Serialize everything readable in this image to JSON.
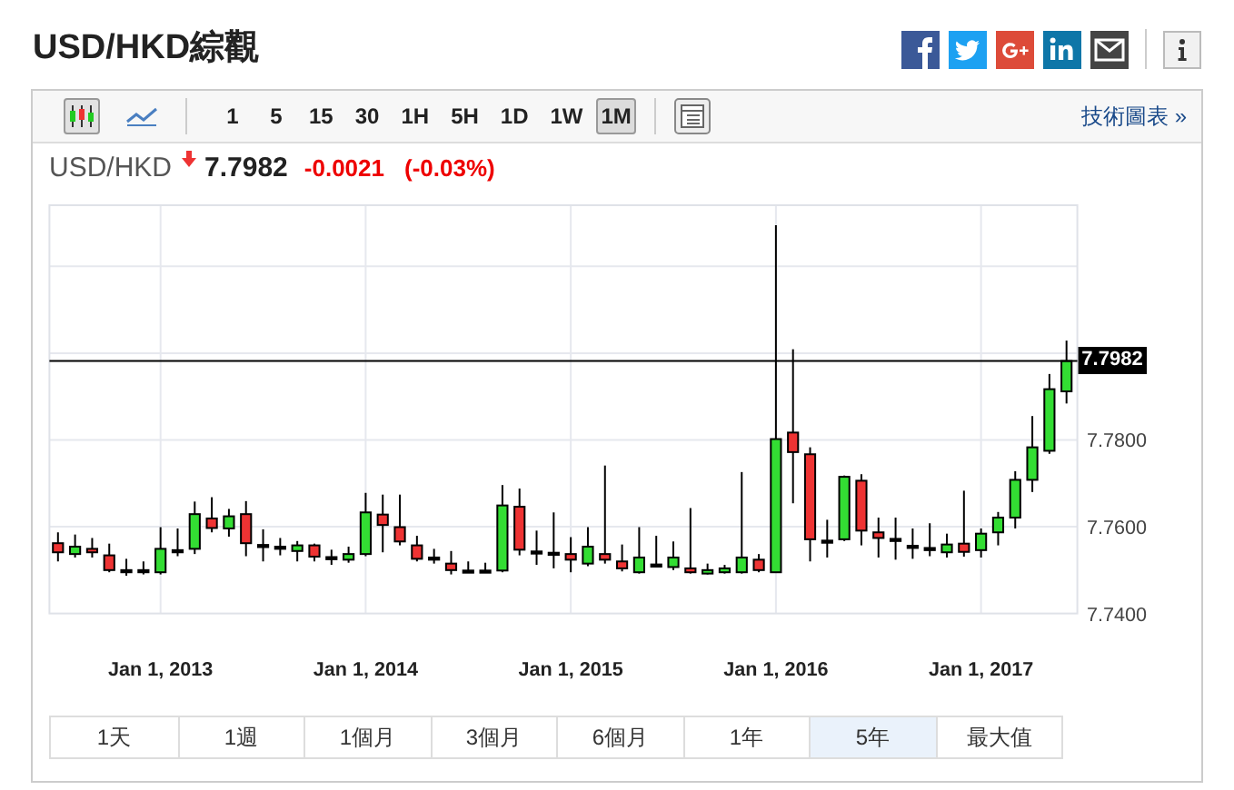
{
  "title": "USD/HKD綜觀",
  "toolbar": {
    "chart_types": [
      {
        "kind": "candles",
        "selected": true
      },
      {
        "kind": "line",
        "selected": false
      }
    ],
    "intervals": [
      {
        "label": "1",
        "selected": false
      },
      {
        "label": "5",
        "selected": false
      },
      {
        "label": "15",
        "selected": false
      },
      {
        "label": "30",
        "selected": false
      },
      {
        "label": "1H",
        "selected": false
      },
      {
        "label": "5H",
        "selected": false
      },
      {
        "label": "1D",
        "selected": false
      },
      {
        "label": "1W",
        "selected": false
      },
      {
        "label": "1M",
        "selected": true
      }
    ],
    "link": "技術圖表 »"
  },
  "quote": {
    "symbol": "USD/HKD",
    "falling": true,
    "price": "7.7982",
    "change": "-0.0021",
    "change_percent": "(-0.03%)"
  },
  "chart": {
    "chart_data": {
      "type": "candlestick",
      "x": [
        "2012-07",
        "2012-08",
        "2012-09",
        "2012-10",
        "2012-11",
        "2012-12",
        "2013-01",
        "2013-02",
        "2013-03",
        "2013-04",
        "2013-05",
        "2013-06",
        "2013-07",
        "2013-08",
        "2013-09",
        "2013-10",
        "2013-11",
        "2013-12",
        "2014-01",
        "2014-02",
        "2014-03",
        "2014-04",
        "2014-05",
        "2014-06",
        "2014-07",
        "2014-08",
        "2014-09",
        "2014-10",
        "2014-11",
        "2014-12",
        "2015-01",
        "2015-02",
        "2015-03",
        "2015-04",
        "2015-05",
        "2015-06",
        "2015-07",
        "2015-08",
        "2015-09",
        "2015-10",
        "2015-11",
        "2015-12",
        "2016-01",
        "2016-02",
        "2016-03",
        "2016-04",
        "2016-05",
        "2016-06",
        "2016-07",
        "2016-08",
        "2016-09",
        "2016-10",
        "2016-11",
        "2016-12",
        "2017-01",
        "2017-02",
        "2017-03",
        "2017-04",
        "2017-05",
        "2017-06"
      ],
      "ohlc": [
        [
          7.7562,
          7.7587,
          7.752,
          7.7541
        ],
        [
          7.7537,
          7.7582,
          7.7529,
          7.7554
        ],
        [
          7.7549,
          7.7574,
          7.7529,
          7.7541
        ],
        [
          7.7534,
          7.7561,
          7.7495,
          7.75
        ],
        [
          7.75,
          7.7526,
          7.7487,
          7.75
        ],
        [
          7.75,
          7.752,
          7.749,
          7.75
        ],
        [
          7.7495,
          7.7599,
          7.749,
          7.7549
        ],
        [
          7.7546,
          7.7596,
          7.7532,
          7.7546
        ],
        [
          7.7549,
          7.7658,
          7.7537,
          7.7629
        ],
        [
          7.7619,
          7.7668,
          7.7587,
          7.7597
        ],
        [
          7.7596,
          7.7641,
          7.7577,
          7.7624
        ],
        [
          7.7629,
          7.7659,
          7.7532,
          7.7562
        ],
        [
          7.7558,
          7.7594,
          7.752,
          7.7558
        ],
        [
          7.7554,
          7.7574,
          7.7534,
          7.7554
        ],
        [
          7.7544,
          7.7567,
          7.752,
          7.7557
        ],
        [
          7.7557,
          7.7561,
          7.752,
          7.7531
        ],
        [
          7.753,
          7.7547,
          7.7512,
          7.753
        ],
        [
          7.7524,
          7.7554,
          7.7517,
          7.7537
        ],
        [
          7.7537,
          7.7678,
          7.7532,
          7.7633
        ],
        [
          7.7628,
          7.7674,
          7.7541,
          7.7604
        ],
        [
          7.7599,
          7.7674,
          7.7557,
          7.7566
        ],
        [
          7.7557,
          7.7579,
          7.752,
          7.7526
        ],
        [
          7.7529,
          7.7549,
          7.7515,
          7.7529
        ],
        [
          7.7515,
          7.7544,
          7.749,
          7.75
        ],
        [
          7.7499,
          7.752,
          7.7494,
          7.7499
        ],
        [
          7.7499,
          7.7517,
          7.7494,
          7.7499
        ],
        [
          7.7499,
          7.7696,
          7.7495,
          7.7649
        ],
        [
          7.7646,
          7.7688,
          7.7534,
          7.7547
        ],
        [
          7.7543,
          7.7591,
          7.7512,
          7.7543
        ],
        [
          7.754,
          7.7633,
          7.7504,
          7.754
        ],
        [
          7.7537,
          7.7576,
          7.7495,
          7.7524
        ],
        [
          7.7515,
          7.7599,
          7.7509,
          7.7554
        ],
        [
          7.7537,
          7.7741,
          7.7515,
          7.7524
        ],
        [
          7.752,
          7.7559,
          7.7497,
          7.7504
        ],
        [
          7.7495,
          7.7599,
          7.7492,
          7.7529
        ],
        [
          7.7513,
          7.7579,
          7.7509,
          7.7513
        ],
        [
          7.7507,
          7.7566,
          7.75,
          7.7529
        ],
        [
          7.7504,
          7.7643,
          7.7492,
          7.7495
        ],
        [
          7.7492,
          7.7515,
          7.749,
          7.75
        ],
        [
          7.7495,
          7.7512,
          7.7492,
          7.7504
        ],
        [
          7.7495,
          7.7726,
          7.7492,
          7.7529
        ],
        [
          7.7524,
          7.7537,
          7.7495,
          7.75
        ],
        [
          7.7495,
          7.8295,
          7.7495,
          7.7802
        ],
        [
          7.7817,
          7.8009,
          7.7654,
          7.7772
        ],
        [
          7.7767,
          7.7783,
          7.752,
          7.7571
        ],
        [
          7.7568,
          7.7616,
          7.7529,
          7.7568
        ],
        [
          7.7571,
          7.7718,
          7.7567,
          7.7715
        ],
        [
          7.7706,
          7.7721,
          7.7557,
          7.7591
        ],
        [
          7.7587,
          7.7621,
          7.7529,
          7.7574
        ],
        [
          7.7572,
          7.7621,
          7.7524,
          7.7572
        ],
        [
          7.7556,
          7.7596,
          7.7526,
          7.7556
        ],
        [
          7.7551,
          7.7608,
          7.7532,
          7.7551
        ],
        [
          7.7541,
          7.7584,
          7.7529,
          7.7559
        ],
        [
          7.7561,
          7.7683,
          7.7531,
          7.7542
        ],
        [
          7.7546,
          7.7596,
          7.7529,
          7.7584
        ],
        [
          7.7587,
          7.7634,
          7.7557,
          7.7621
        ],
        [
          7.7621,
          7.7728,
          7.7596,
          7.7708
        ],
        [
          7.7708,
          7.7855,
          7.768,
          7.7783
        ],
        [
          7.7775,
          7.7952,
          7.7768,
          7.7917
        ],
        [
          7.7912,
          7.8029,
          7.7884,
          7.7982
        ]
      ],
      "xlim": [
        "2012-06-16",
        "2017-06-20"
      ],
      "ylim": [
        7.74,
        7.8341
      ],
      "grid": true,
      "ref_lines": [
        {
          "axis": "y",
          "value": 7.7982,
          "label": "7.7982",
          "color": "#000000"
        }
      ],
      "yticks": [
        {
          "value": 7.78,
          "label": "7.7800"
        },
        {
          "value": 7.76,
          "label": "7.7600"
        },
        {
          "value": 7.74,
          "label": "7.7400"
        }
      ],
      "xticks": [
        {
          "value": "2013-01",
          "label": "Jan 1, 2013"
        },
        {
          "value": "2014-01",
          "label": "Jan 1, 2014"
        },
        {
          "value": "2015-01",
          "label": "Jan 1, 2015"
        },
        {
          "value": "2016-01",
          "label": "Jan 1, 2016"
        },
        {
          "value": "2017-01",
          "label": "Jan 1, 2017"
        }
      ]
    }
  },
  "ranges": [
    {
      "label": "1天",
      "selected": false
    },
    {
      "label": "1週",
      "selected": false
    },
    {
      "label": "1個月",
      "selected": false
    },
    {
      "label": "3個月",
      "selected": false
    },
    {
      "label": "6個月",
      "selected": false
    },
    {
      "label": "1年",
      "selected": false
    },
    {
      "label": "5年",
      "selected": true
    },
    {
      "label": "最大值",
      "selected": false
    }
  ]
}
